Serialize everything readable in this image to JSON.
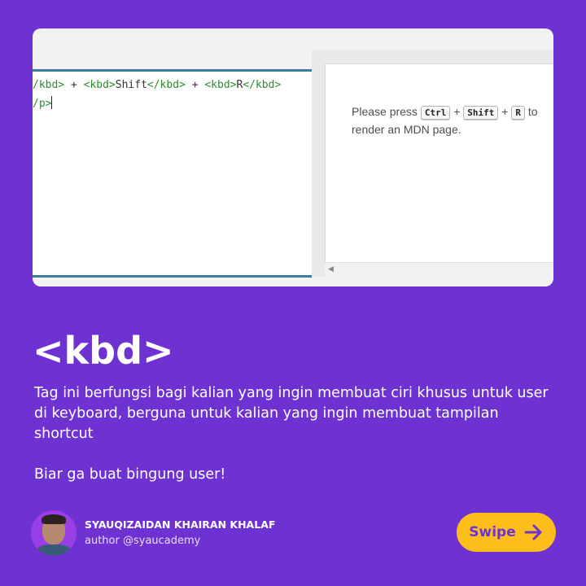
{
  "code_editor": {
    "line1": {
      "pre": "/kbd>",
      "plus1": " + ",
      "kbd_open1": "<kbd>",
      "word1": "Shift",
      "kbd_close1": "</kbd>",
      "plus2": " + ",
      "kbd_open2": "<kbd>",
      "word2": "R",
      "kbd_close2": "</kbd>"
    },
    "line2": "/p>"
  },
  "output": {
    "text_before": "Please press ",
    "key1": "Ctrl",
    "sep1": " + ",
    "key2": "Shift",
    "sep2": " + ",
    "key3": "R",
    "text_after": " to",
    "line2": "render an MDN page.",
    "scroll_left_icon": "triangle-left-icon"
  },
  "heading": "<kbd>",
  "description": "Tag ini berfungsi bagi kalian yang ingin membuat ciri khusus untuk user di keyboard, berguna untuk kalian yang ingin membuat tampilan shortcut",
  "tagline": "Biar ga buat bingung user!",
  "author": {
    "name": "SYAUQIZAIDAN KHAIRAN KHALAF",
    "handle": "author @syaucademy"
  },
  "swipe_button": {
    "label": "Swipe",
    "icon": "arrow-right-icon"
  },
  "colors": {
    "background": "#6f32d2",
    "button": "#fdbe1a",
    "editor_border": "#3d7e9a",
    "code_tag": "#2e8b2e"
  }
}
